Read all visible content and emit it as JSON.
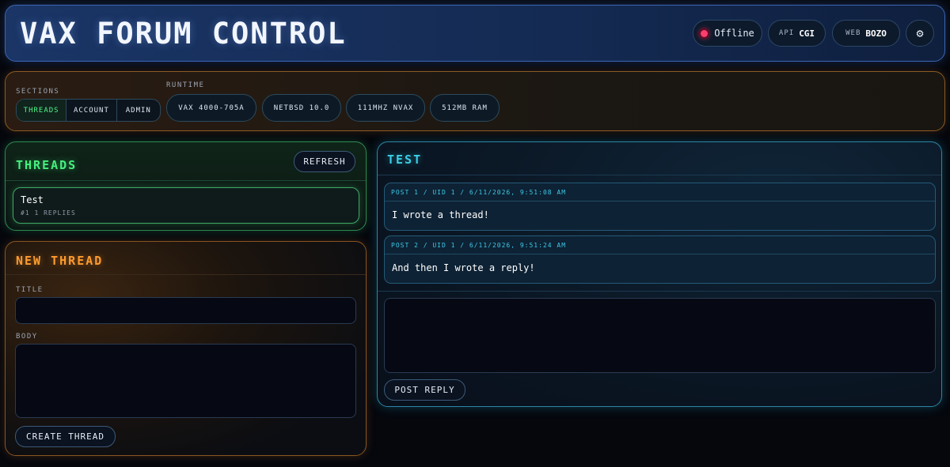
{
  "header": {
    "title": "VAX FORUM CONTROL",
    "status": {
      "label": "Offline",
      "color": "#ff3d6e"
    },
    "api": {
      "key": "API",
      "value": "CGI"
    },
    "web": {
      "key": "WEB",
      "value": "BOZO"
    },
    "settings_icon": "gear-icon",
    "settings_glyph": "⚙"
  },
  "nav": {
    "sections_label": "SECTIONS",
    "tabs": [
      {
        "label": "THREADS",
        "active": true
      },
      {
        "label": "ACCOUNT",
        "active": false
      },
      {
        "label": "ADMIN",
        "active": false
      }
    ],
    "runtime_label": "RUNTIME",
    "runtime": [
      "VAX 4000-705A",
      "NETBSD 10.0",
      "111MHZ NVAX",
      "512MB RAM"
    ]
  },
  "threads": {
    "title": "THREADS",
    "refresh_label": "REFRESH",
    "items": [
      {
        "title": "Test",
        "meta": "#1 1 REPLIES"
      }
    ]
  },
  "new_thread": {
    "title": "NEW THREAD",
    "title_label": "TITLE",
    "title_value": "",
    "body_label": "BODY",
    "body_value": "",
    "create_label": "CREATE THREAD"
  },
  "thread_view": {
    "title": "TEST",
    "posts": [
      {
        "header": "POST 1 / UID 1 / 6/11/2026, 9:51:08 AM",
        "body": "I wrote a thread!"
      },
      {
        "header": "POST 2 / UID 1 / 6/11/2026, 9:51:24 AM",
        "body": "And then I wrote a reply!"
      }
    ],
    "reply_value": "",
    "post_reply_label": "POST REPLY"
  },
  "colors": {
    "accent_blue": "#3c66b4",
    "accent_orange": "#ff9b2e",
    "accent_green": "#45f07e",
    "accent_cyan": "#39d0e8"
  }
}
